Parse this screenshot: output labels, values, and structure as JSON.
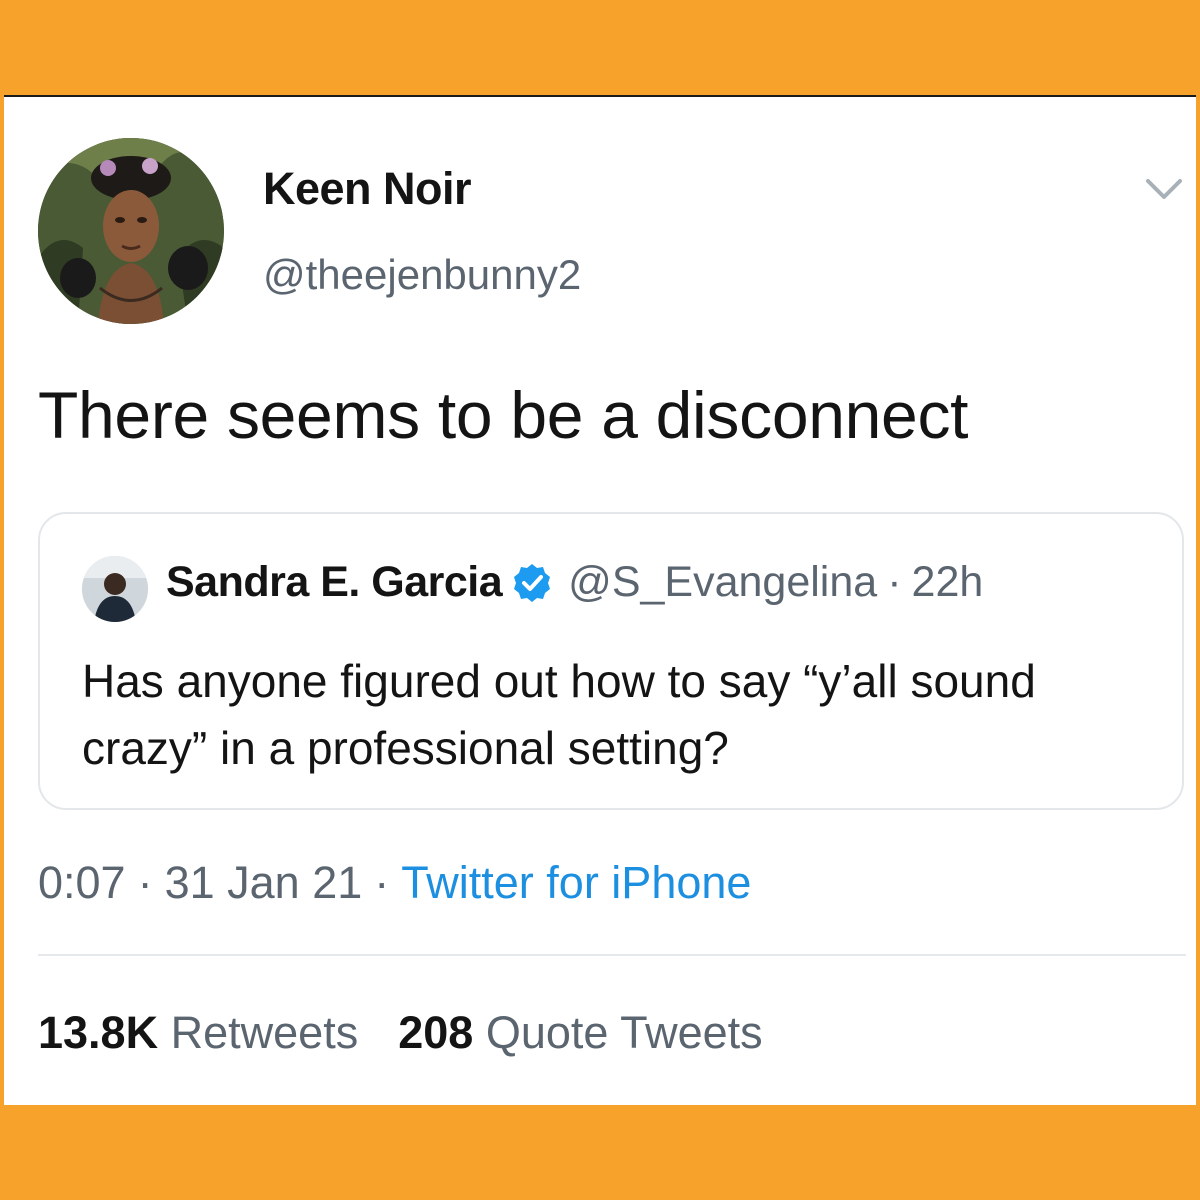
{
  "tweet": {
    "display_name": "Keen Noir",
    "handle": "@theejenbunny2",
    "text": "There seems to be a disconnect",
    "timestamp_time": "0:07",
    "timestamp_date": "31 Jan 21",
    "source": "Twitter for iPhone",
    "separator": "·",
    "menu_icon": "chevron-down-icon"
  },
  "quoted_tweet": {
    "display_name": "Sandra E. Garcia",
    "verified_icon": "verified-badge-icon",
    "handle": "@S_Evangelina",
    "separator": "·",
    "time": "22h",
    "text": "Has anyone figured out how to say “y’all sound crazy” in a professional setting?"
  },
  "stats": {
    "retweets_count": "13.8K",
    "retweets_label": "Retweets",
    "quotes_count": "208",
    "quotes_label": "Quote Tweets"
  },
  "colors": {
    "frame": "#f6a22b",
    "link": "#1d8fe0",
    "verified": "#1d9bf0",
    "secondary_text": "#5b6570"
  }
}
